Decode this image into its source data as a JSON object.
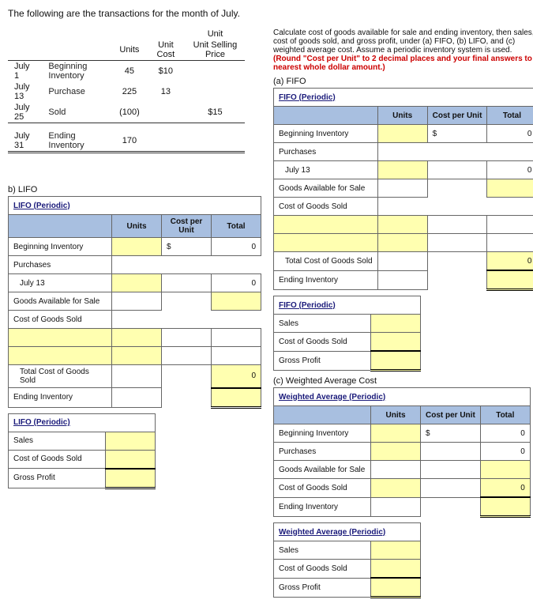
{
  "intro": "The following are the transactions for the month of July.",
  "given": {
    "headers": {
      "units": "Units",
      "unitCost": "Unit Cost",
      "unitSP": "Unit Selling Price",
      "unit": "Unit"
    },
    "rows": {
      "r1": {
        "date": "July 1",
        "label": "Beginning Inventory",
        "units": "45",
        "cost": "$10",
        "sp": ""
      },
      "r2": {
        "date": "July 13",
        "label": "Purchase",
        "units": "225",
        "cost": "13",
        "sp": ""
      },
      "r3": {
        "date": "July 25",
        "label": "Sold",
        "units": "(100)",
        "cost": "",
        "sp": "$15"
      },
      "r4": {
        "date": "July 31",
        "label": "Ending Inventory",
        "units": "170",
        "cost": "",
        "sp": ""
      }
    }
  },
  "instr": {
    "text": "Calculate cost of goods available for sale and ending inventory, then sales, cost of goods sold, and gross profit, under (a) FIFO, (b) LIFO, and (c) weighted average cost. Assume a periodic inventory system is used. ",
    "red": "(Round \"Cost per Unit\" to 2 decimal places and your final answers to nearest whole dollar amount.)"
  },
  "parts": {
    "a": "(a) FIFO",
    "b": "b) LIFO",
    "c": "(c) Weighted Average Cost"
  },
  "tblHeaders": {
    "units": "Units",
    "cpu": "Cost per Unit",
    "total": "Total"
  },
  "rowsCommon": {
    "begInv": "Beginning Inventory",
    "purch": "Purchases",
    "jul13": "July 13",
    "gafs": "Goods Available for Sale",
    "cogsLabel": "Cost of Goods Sold",
    "totCogs": "Total Cost of Goods Sold",
    "endInv": "Ending Inventory",
    "sales": "Sales",
    "cogs": "Cost of Goods Sold",
    "gp": "Gross Profit"
  },
  "titles": {
    "fifo": "FIFO (Periodic)",
    "lifo": "LIFO (Periodic)",
    "wavg": "Weighted Average (Periodic)"
  },
  "vals": {
    "dollar": "$",
    "zero": "0"
  }
}
